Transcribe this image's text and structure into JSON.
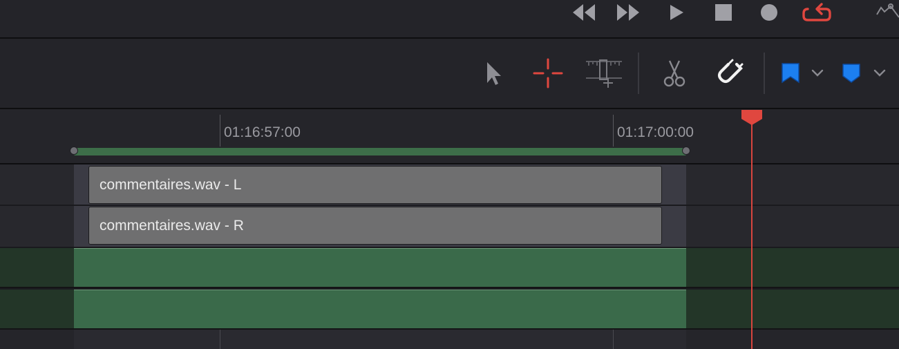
{
  "transport": {
    "buttons": [
      "rewind",
      "fast-forward",
      "play",
      "stop",
      "record",
      "loop"
    ]
  },
  "toolbar": {
    "tools": [
      "selection",
      "range",
      "trim",
      "razor",
      "snapping",
      "flag",
      "marker"
    ]
  },
  "ruler": {
    "timecodes": [
      "01:16:57:00",
      "01:17:00:00"
    ]
  },
  "tracks": {
    "clips": [
      {
        "label": "commentaires.wav - L"
      },
      {
        "label": "commentaires.wav - R"
      }
    ]
  },
  "colors": {
    "accent_red": "#e0473f",
    "flag_blue": "#1c7ff0",
    "selection_green": "#3a6a4a"
  }
}
